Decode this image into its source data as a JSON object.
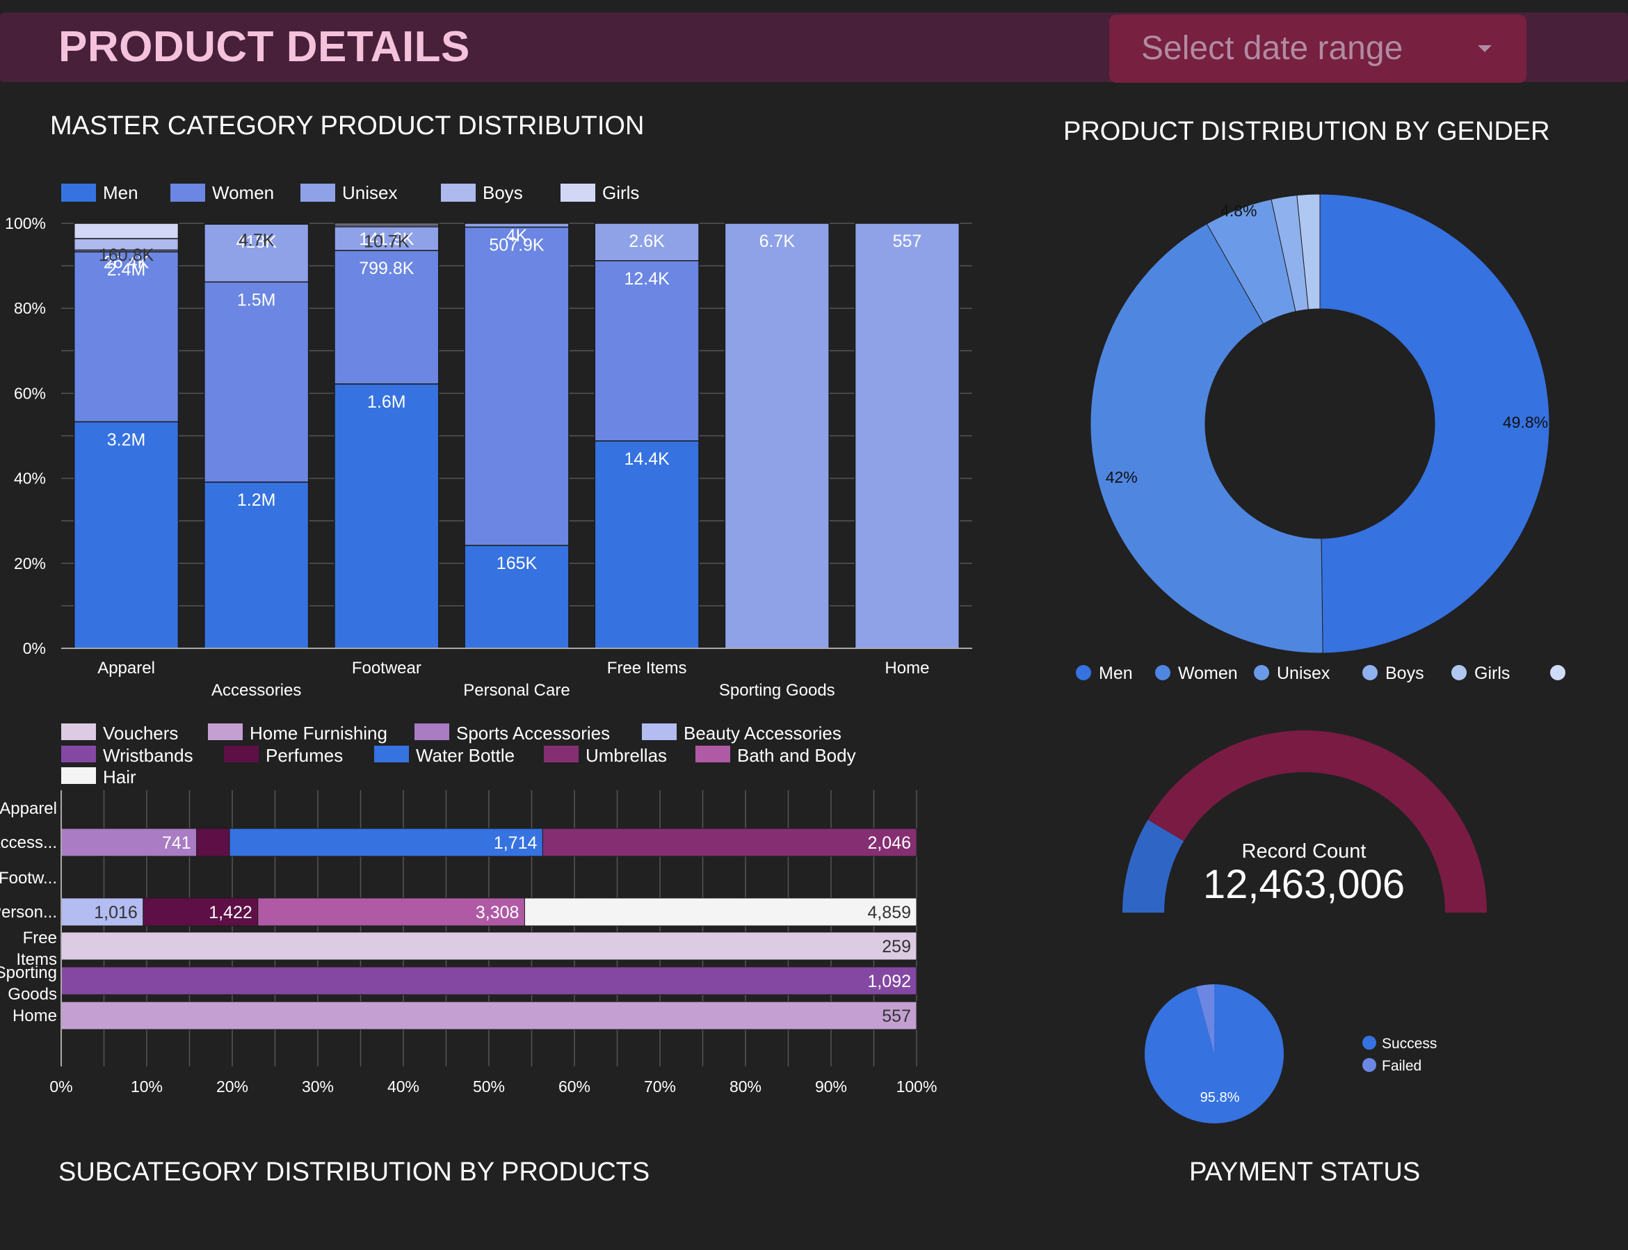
{
  "header": {
    "title": "PRODUCT DETAILS",
    "date_range_placeholder": "Select date range"
  },
  "sections": {
    "master_title": "MASTER CATEGORY PRODUCT DISTRIBUTION",
    "gender_title": "PRODUCT DISTRIBUTION BY GENDER",
    "sub_title": "SUBCATEGORY DISTRIBUTION BY PRODUCTS",
    "payment_title": "PAYMENT STATUS"
  },
  "colors": {
    "men": "#3672e0",
    "women": "#6b87e3",
    "unisex": "#8fa2e8",
    "boys": "#aeb9ee",
    "girls": "#d2d7f5",
    "gauge_blue": "#2f66c6",
    "gauge_red": "#7a1b44"
  },
  "chart_data": [
    {
      "id": "master",
      "type": "bar",
      "stacked": "percent",
      "categories": [
        "Apparel",
        "Accessories",
        "Footwear",
        "Personal Care",
        "Free Items",
        "Sporting Goods",
        "Home"
      ],
      "yticks": [
        "0%",
        "20%",
        "40%",
        "60%",
        "80%",
        "100%"
      ],
      "legend_position": "top-left",
      "grid": true,
      "series": [
        {
          "name": "Men",
          "color": "#3672e0",
          "values": [
            53.3,
            39.1,
            62.2,
            24.2,
            48.8,
            0,
            0
          ],
          "labels": [
            "3.2M",
            "1.2M",
            "1.6M",
            "165K",
            "14.4K",
            "",
            ""
          ]
        },
        {
          "name": "Women",
          "color": "#6b87e3",
          "values": [
            40.0,
            47.1,
            31.4,
            74.9,
            42.4,
            0,
            0
          ],
          "labels": [
            "2.4M",
            "1.5M",
            "799.8K",
            "507.9K",
            "12.4K",
            "",
            ""
          ]
        },
        {
          "name": "Unisex",
          "color": "#8fa2e8",
          "values": [
            0.4,
            13.6,
            5.6,
            0.9,
            8.8,
            100,
            100
          ],
          "labels": [
            "26.4K",
            "418K",
            "141.9K",
            "4K",
            "2.6K",
            "6.7K",
            "557"
          ]
        },
        {
          "name": "Boys",
          "color": "#aeb9ee",
          "values": [
            2.7,
            0.15,
            0.4,
            0,
            0,
            0,
            0
          ],
          "labels": [
            "160.8K",
            "4.7K",
            "10.7K",
            "",
            "",
            "",
            ""
          ]
        },
        {
          "name": "Girls",
          "color": "#d2d7f5",
          "values": [
            3.6,
            0.05,
            0.4,
            0,
            0,
            0,
            0
          ],
          "labels": [
            "",
            "",
            "",
            "",
            "",
            "",
            ""
          ]
        }
      ]
    },
    {
      "id": "gender",
      "type": "pie",
      "donut": true,
      "legend_position": "bottom",
      "slices": [
        {
          "name": "Men",
          "value": 49.8,
          "color": "#3672e0",
          "label": "49.8%"
        },
        {
          "name": "Women",
          "value": 42.0,
          "color": "#4f86e0",
          "label": "42%"
        },
        {
          "name": "Unisex",
          "value": 4.8,
          "color": "#6b9be8",
          "label": "4.8%"
        },
        {
          "name": "Boys",
          "value": 1.8,
          "color": "#8fb1ee",
          "label": ""
        },
        {
          "name": "Girls",
          "value": 1.6,
          "color": "#afc8f2",
          "label": ""
        }
      ],
      "legend": [
        {
          "name": "Men",
          "color": "#3672e0"
        },
        {
          "name": "Women",
          "color": "#4f86e0"
        },
        {
          "name": "Unisex",
          "color": "#6b9be8"
        },
        {
          "name": "Boys",
          "color": "#8fb1ee"
        },
        {
          "name": "Girls",
          "color": "#afc8f2"
        },
        {
          "name": "",
          "color": "#cfdcf7"
        }
      ]
    },
    {
      "id": "subcategory",
      "type": "bar",
      "orientation": "horizontal",
      "stacked": "percent",
      "categories": [
        "Apparel",
        "Access...",
        "Footw...",
        "Person...",
        "Free Items",
        "Sporting Goods",
        "Home"
      ],
      "xticks": [
        "0%",
        "10%",
        "20%",
        "30%",
        "40%",
        "50%",
        "60%",
        "70%",
        "80%",
        "90%",
        "100%"
      ],
      "legend_position": "top-left",
      "grid": true,
      "legend": [
        {
          "name": "Vouchers",
          "color": "#dccbe3"
        },
        {
          "name": "Home Furnishing",
          "color": "#c4a0d2"
        },
        {
          "name": "Sports Accessories",
          "color": "#a97cc4"
        },
        {
          "name": "Beauty Accessories",
          "color": "#b3bdf2"
        },
        {
          "name": "Wristbands",
          "color": "#8448a3"
        },
        {
          "name": "Perfumes",
          "color": "#5d0f46"
        },
        {
          "name": "Water Bottle",
          "color": "#3672e0"
        },
        {
          "name": "Umbrellas",
          "color": "#852f72"
        },
        {
          "name": "Bath and Body",
          "color": "#b05aa6"
        },
        {
          "name": "Hair",
          "color": "#f4f4f4"
        }
      ],
      "rows": [
        {
          "category": "Apparel",
          "segments": []
        },
        {
          "category": "Access...",
          "segments": [
            {
              "series": "Sports Accessories",
              "value": 741,
              "label": "741"
            },
            {
              "series": "Perfumes",
              "value": 180,
              "label": "180"
            },
            {
              "series": "Water Bottle",
              "value": 1714,
              "label": "1,714"
            },
            {
              "series": "Umbrellas",
              "value": 2046,
              "label": "2,046"
            }
          ]
        },
        {
          "category": "Footw...",
          "segments": []
        },
        {
          "category": "Person...",
          "segments": [
            {
              "series": "Beauty Accessories",
              "value": 1016,
              "label": "1,016"
            },
            {
              "series": "Perfumes",
              "value": 1422,
              "label": "1,422"
            },
            {
              "series": "Bath and Body",
              "value": 3308,
              "label": "3,308"
            },
            {
              "series": "Hair",
              "value": 4859,
              "label": "4,859"
            }
          ]
        },
        {
          "category": "Free Items",
          "segments": [
            {
              "series": "Vouchers",
              "value": 259,
              "label": "259"
            }
          ]
        },
        {
          "category": "Sporting Goods",
          "segments": [
            {
              "series": "Wristbands",
              "value": 1092,
              "label": "1,092"
            }
          ]
        },
        {
          "category": "Home",
          "segments": [
            {
              "series": "Home Furnishing",
              "value": 557,
              "label": "557"
            }
          ]
        }
      ]
    },
    {
      "id": "record_gauge",
      "type": "gauge",
      "label": "Record Count",
      "value_text": "12,463,006",
      "fill_fraction": 0.17
    },
    {
      "id": "payment",
      "type": "pie",
      "legend_position": "right",
      "slices": [
        {
          "name": "Success",
          "value": 95.8,
          "color": "#3672e0",
          "label": "95.8%"
        },
        {
          "name": "Failed",
          "value": 4.2,
          "color": "#6b87e3",
          "label": ""
        }
      ]
    }
  ]
}
